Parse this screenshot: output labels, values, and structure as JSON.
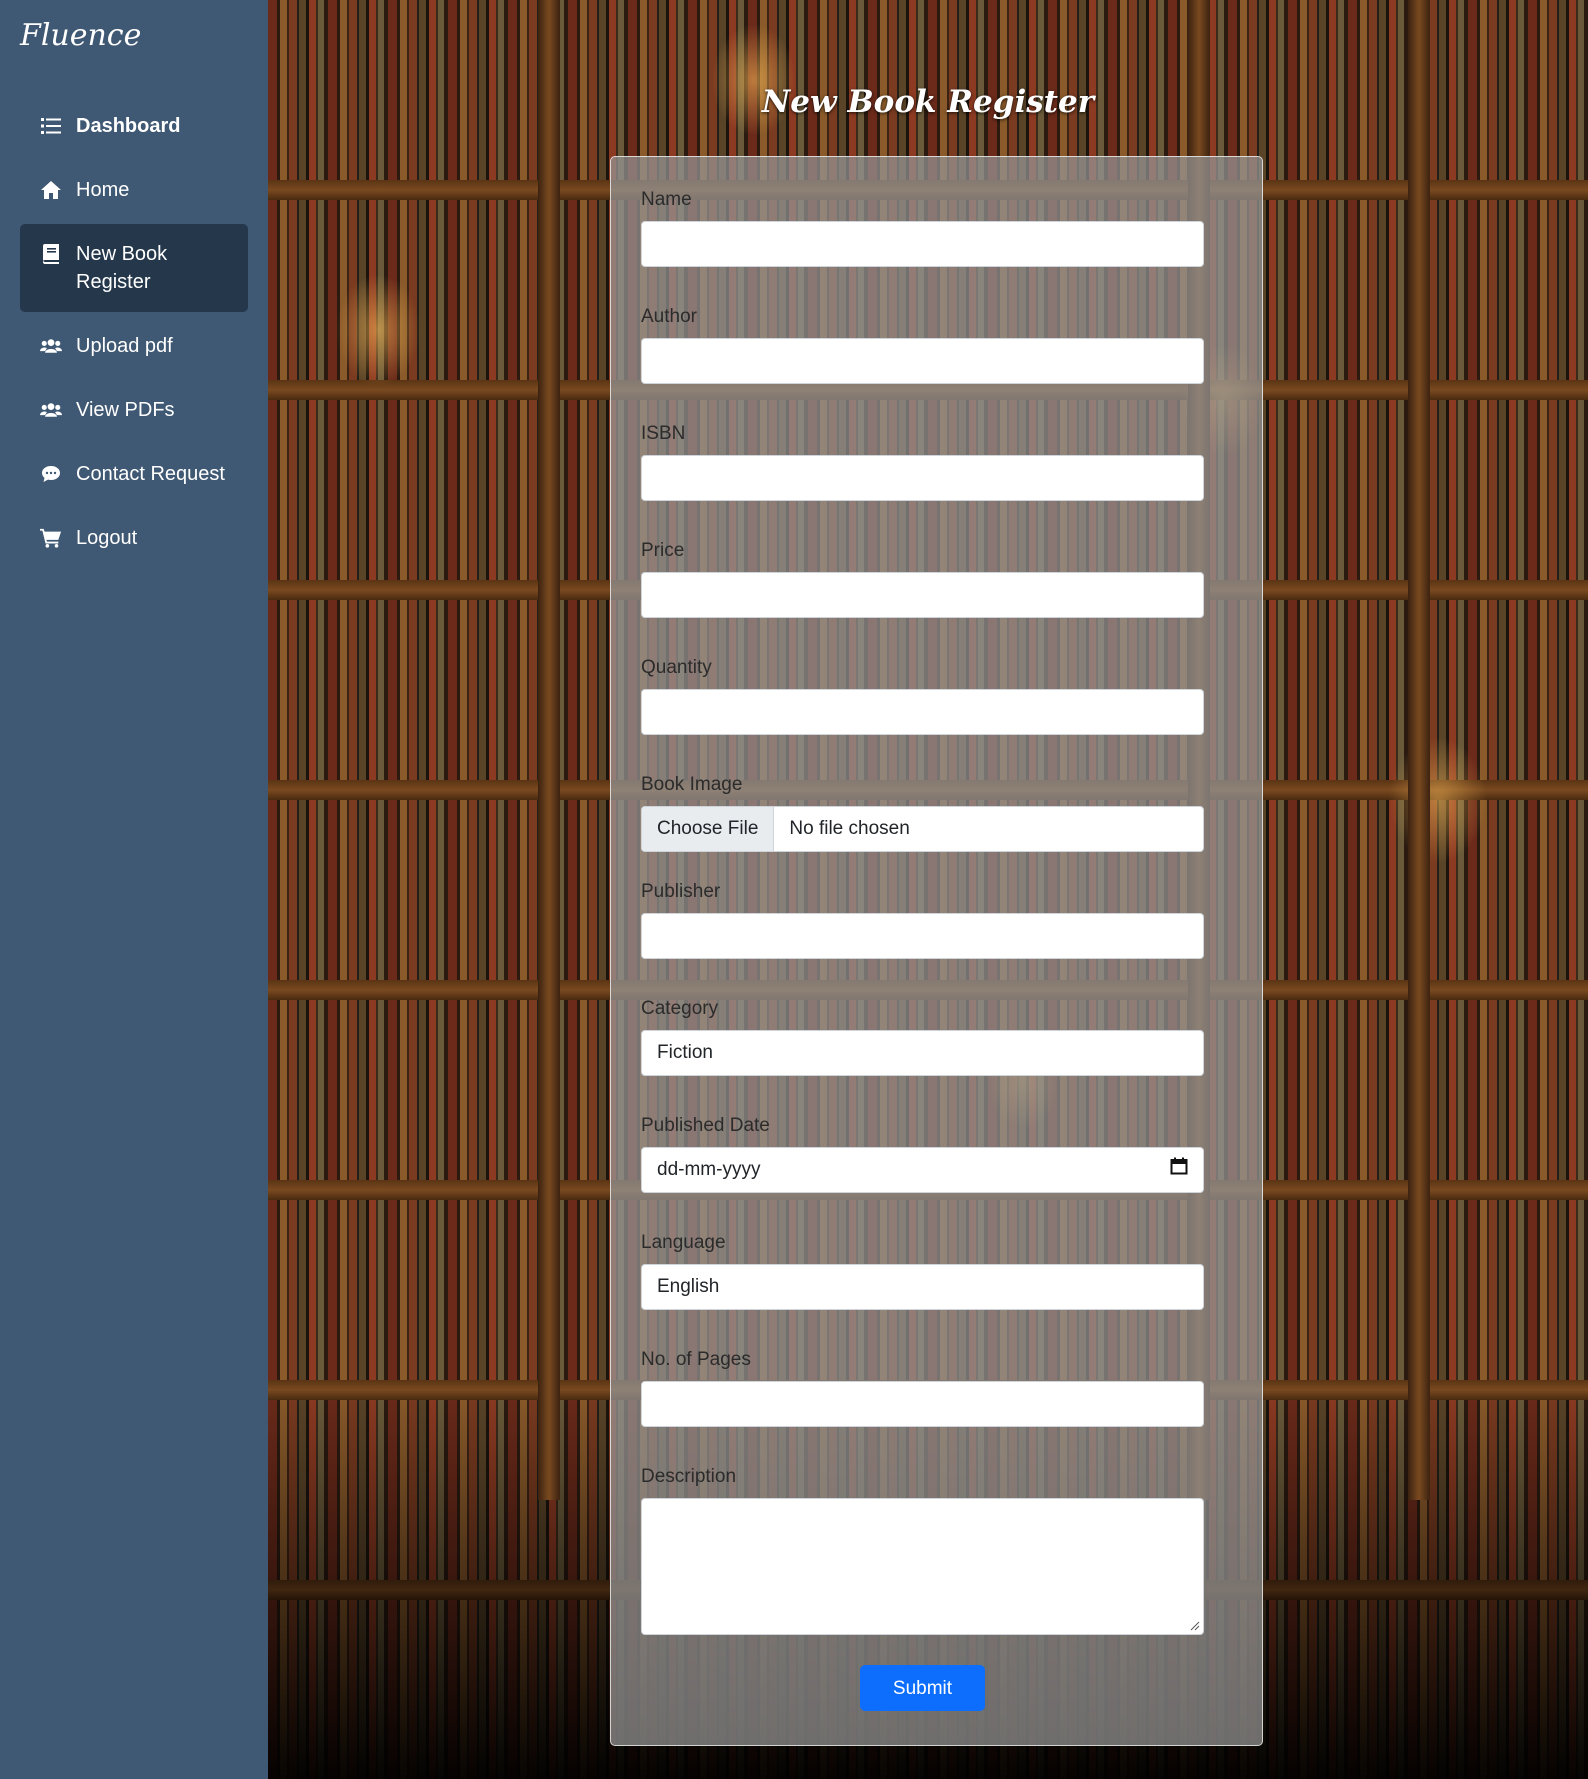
{
  "app": {
    "brand": "Fluence"
  },
  "sidebar": {
    "items": [
      {
        "label": "Dashboard",
        "icon": "list-icon",
        "active": false
      },
      {
        "label": "Home",
        "icon": "home-icon",
        "active": false
      },
      {
        "label": "New Book Register",
        "icon": "book-icon",
        "active": true
      },
      {
        "label": "Upload pdf",
        "icon": "users-icon",
        "active": false
      },
      {
        "label": "View PDFs",
        "icon": "users-icon",
        "active": false
      },
      {
        "label": "Contact Request",
        "icon": "comment-icon",
        "active": false
      },
      {
        "label": "Logout",
        "icon": "cart-icon",
        "active": false
      }
    ]
  },
  "page": {
    "title": "New Book Register"
  },
  "form": {
    "name": {
      "label": "Name",
      "value": ""
    },
    "author": {
      "label": "Author",
      "value": ""
    },
    "isbn": {
      "label": "ISBN",
      "value": ""
    },
    "price": {
      "label": "Price",
      "value": ""
    },
    "quantity": {
      "label": "Quantity",
      "value": ""
    },
    "book_image": {
      "label": "Book Image",
      "button": "Choose File",
      "status": "No file chosen"
    },
    "publisher": {
      "label": "Publisher",
      "value": ""
    },
    "category": {
      "label": "Category",
      "value": "Fiction"
    },
    "published_date": {
      "label": "Published Date",
      "placeholder": "dd-mm-yyyy"
    },
    "language": {
      "label": "Language",
      "value": "English"
    },
    "pages": {
      "label": "No. of Pages",
      "value": ""
    },
    "description": {
      "label": "Description",
      "value": ""
    },
    "submit_label": "Submit"
  },
  "colors": {
    "sidebar": "#3f5873",
    "sidebar_active": "#24374b",
    "submit": "#0d6efd"
  }
}
